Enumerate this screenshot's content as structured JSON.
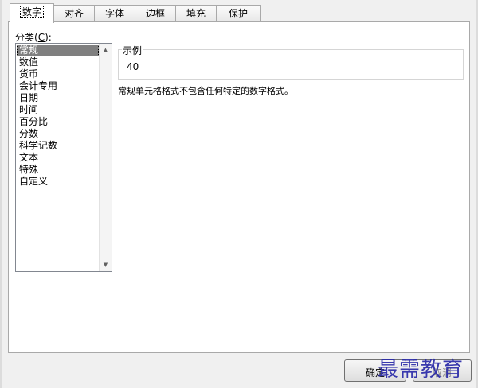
{
  "tabs": [
    {
      "label": "数字",
      "active": true
    },
    {
      "label": "对齐",
      "active": false
    },
    {
      "label": "字体",
      "active": false
    },
    {
      "label": "边框",
      "active": false
    },
    {
      "label": "填充",
      "active": false
    },
    {
      "label": "保护",
      "active": false
    }
  ],
  "category": {
    "label_prefix": "分类(",
    "label_key": "C",
    "label_suffix": "):",
    "selected": "常规",
    "items": [
      "常规",
      "数值",
      "货币",
      "会计专用",
      "日期",
      "时间",
      "百分比",
      "分数",
      "科学记数",
      "文本",
      "特殊",
      "自定义"
    ]
  },
  "sample": {
    "legend": "示例",
    "value": "40"
  },
  "description": "常规单元格格式不包含任何特定的数字格式。",
  "buttons": {
    "ok_label": "确定",
    "cancel_label": "取消"
  },
  "watermark": "最需教育",
  "icons": {
    "scroll_up": "arrow-up-icon",
    "scroll_down": "arrow-down-icon"
  }
}
